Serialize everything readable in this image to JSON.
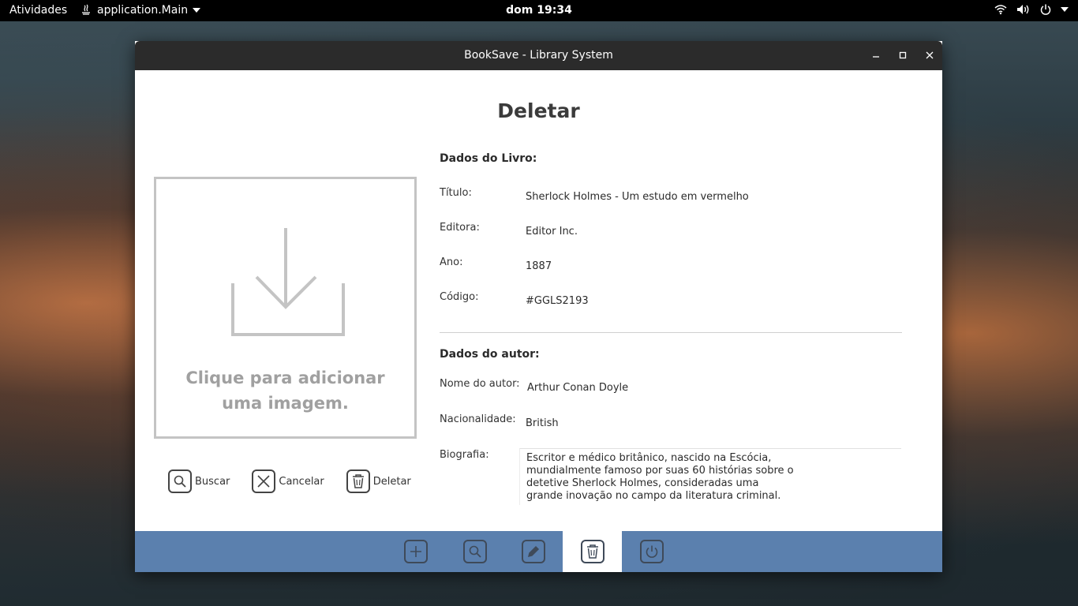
{
  "topbar": {
    "activities": "Atividades",
    "app_name": "application.Main",
    "clock": "dom 19:34"
  },
  "window": {
    "title": "BookSave - Library System"
  },
  "page": {
    "title": "Deletar",
    "dropzone_text": "Clique para adicionar uma imagem."
  },
  "actions": {
    "search": "Buscar",
    "cancel": "Cancelar",
    "delete": "Deletar"
  },
  "book": {
    "heading": "Dados do Livro:",
    "title_label": "Título:",
    "title_value": "Sherlock Holmes - Um estudo em vermelho",
    "publisher_label": "Editora:",
    "publisher_value": "Editor Inc.",
    "year_label": "Ano:",
    "year_value": "1887",
    "code_label": "Código:",
    "code_value": "#GGLS2193"
  },
  "author": {
    "heading": "Dados do autor:",
    "name_label": "Nome do autor:",
    "name_value": "Arthur Conan Doyle",
    "nationality_label": "Nacionalidade:",
    "nationality_value": "British",
    "bio_label": "Biografia:",
    "bio_value": "Escritor e médico britânico, nascido na Escócia, mundialmente famoso por suas 60 histórias sobre o detetive Sherlock Holmes, consideradas uma grande inovação no campo da literatura criminal."
  },
  "navbar": {
    "items": [
      "add-icon",
      "search-icon",
      "edit-icon",
      "trash-icon",
      "power-icon"
    ],
    "active": "trash-icon",
    "color": "#5b80ae"
  }
}
